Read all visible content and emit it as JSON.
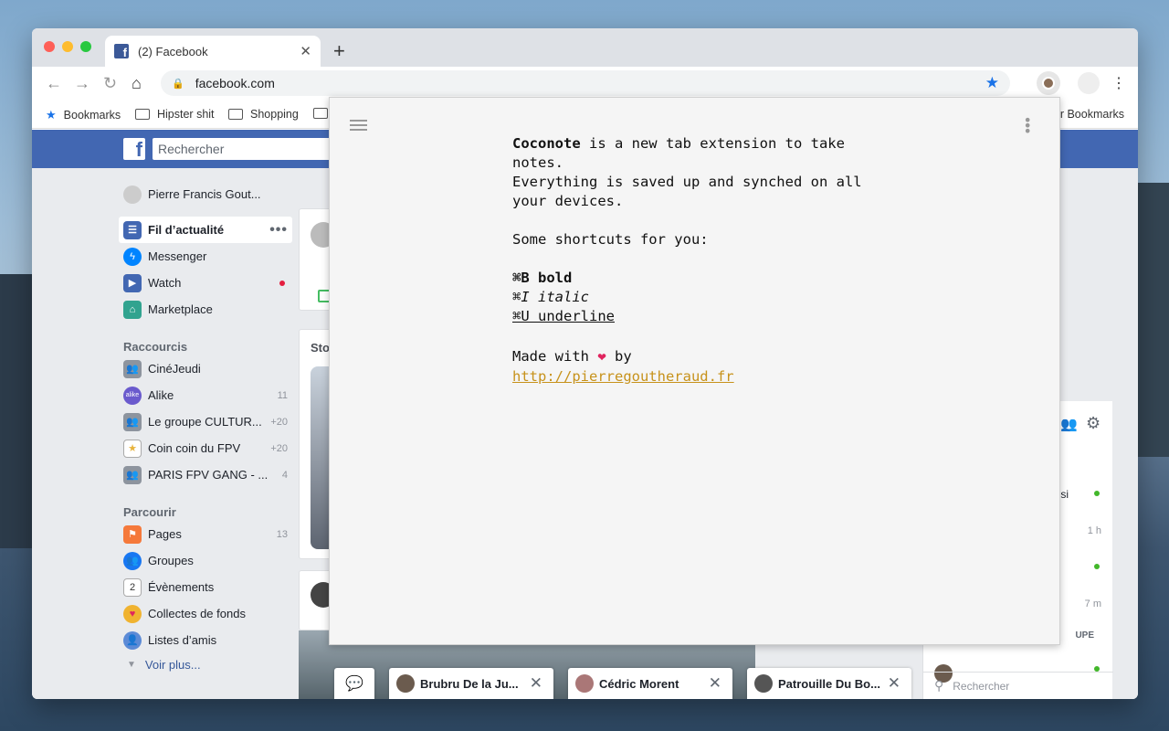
{
  "browser": {
    "tab_title": "(2) Facebook",
    "tab_favicon": "f",
    "url": "facebook.com",
    "bookmarks": [
      "Bookmarks",
      "Hipster shit",
      "Shopping"
    ],
    "other_bookmarks": "Other Bookmarks"
  },
  "facebook": {
    "search_placeholder": "Rechercher",
    "user_name": "Pierre Francis Gout...",
    "main_nav": [
      {
        "label": "Fil d’actualité",
        "icon": "newsfeed-icon"
      },
      {
        "label": "Messenger",
        "icon": "messenger-icon"
      },
      {
        "label": "Watch",
        "icon": "watch-icon"
      },
      {
        "label": "Marketplace",
        "icon": "marketplace-icon"
      }
    ],
    "shortcuts_title": "Raccourcis",
    "shortcuts": [
      {
        "label": "CinéJeudi",
        "count": ""
      },
      {
        "label": "Alike",
        "count": "11"
      },
      {
        "label": "Le groupe CULTUR...",
        "count": "+20"
      },
      {
        "label": "Coin coin du FPV",
        "count": "+20"
      },
      {
        "label": "PARIS FPV GANG - ...",
        "count": "4"
      }
    ],
    "explore_title": "Parcourir",
    "explore": [
      {
        "label": "Pages",
        "count": "13"
      },
      {
        "label": "Groupes",
        "count": ""
      },
      {
        "label": "Évènements",
        "count": ""
      },
      {
        "label": "Collectes de fonds",
        "count": ""
      },
      {
        "label": "Listes d’amis",
        "count": ""
      }
    ],
    "see_more": "Voir plus...",
    "stories_title": "Sto",
    "right_panel": {
      "times": [
        "1 h",
        "7 m"
      ],
      "group_fragment": "UPE",
      "text_fragment": "ssi",
      "search": "Rechercher"
    },
    "chats": [
      {
        "name": "Brubru De la Ju..."
      },
      {
        "name": "Cédric Morent"
      },
      {
        "name": "Patrouille Du Bo..."
      }
    ]
  },
  "coconote": {
    "brand": "Coconote",
    "intro_rest": " is a new tab extension to take notes.",
    "line2": "Everything is saved up and synched on all your devices.",
    "shortcuts_header": "Some shortcuts for you:",
    "bold": "⌘B bold",
    "italic": "⌘I italic",
    "underline": "⌘U underline",
    "made_with": "Made with",
    "by": "by",
    "link": "http://pierregoutheraud.fr"
  }
}
